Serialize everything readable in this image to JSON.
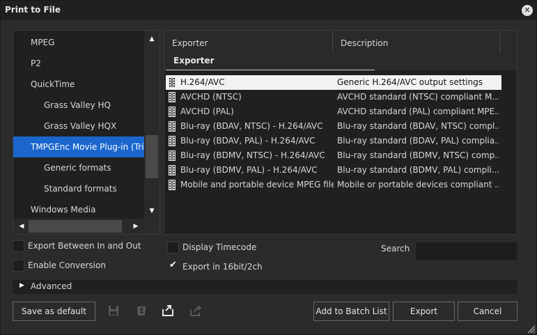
{
  "window": {
    "title": "Print to File",
    "close_glyph": "✕"
  },
  "left_list": {
    "items": [
      {
        "label": "MPEG",
        "level": 0,
        "selected": false
      },
      {
        "label": "P2",
        "level": 0,
        "selected": false
      },
      {
        "label": "QuickTime",
        "level": 0,
        "selected": false
      },
      {
        "label": "Grass Valley HQ",
        "level": 1,
        "selected": false
      },
      {
        "label": "Grass Valley HQX",
        "level": 1,
        "selected": false
      },
      {
        "label": "TMPGEnc Movie Plug-in (Tria",
        "level": 0,
        "selected": true
      },
      {
        "label": "Generic formats",
        "level": 1,
        "selected": false
      },
      {
        "label": "Standard formats",
        "level": 1,
        "selected": false
      },
      {
        "label": "Windows Media",
        "level": 0,
        "selected": false
      }
    ],
    "scroll_up": "▲",
    "scroll_down": "▼",
    "scroll_left": "◀",
    "scroll_right": "▶"
  },
  "exporter_table": {
    "columns": [
      "Exporter",
      "Description"
    ],
    "group": "Exporter",
    "row_icon": "film-strip-icon",
    "rows": [
      {
        "name": "H.264/AVC",
        "description": "Generic H.264/AVC output settings",
        "selected": true
      },
      {
        "name": "AVCHD (NTSC)",
        "description": "AVCHD standard (NTSC) compliant M...",
        "selected": false
      },
      {
        "name": "AVCHD (PAL)",
        "description": "AVCHD standard (PAL) compliant MPE...",
        "selected": false
      },
      {
        "name": "Blu-ray (BDAV, NTSC) - H.264/AVC",
        "description": "Blu-ray standard (BDAV, NTSC) compl...",
        "selected": false
      },
      {
        "name": "Blu-ray (BDAV, PAL) - H.264/AVC",
        "description": "Blu-ray standard (BDAV, PAL) complia...",
        "selected": false
      },
      {
        "name": "Blu-ray (BDMV, NTSC) - H.264/AVC",
        "description": "Blu-ray standard (BDMV, NTSC) comp...",
        "selected": false
      },
      {
        "name": "Blu-ray (BDMV, PAL) - H.264/AVC",
        "description": "Blu-ray standard (BDMV, PAL) compli...",
        "selected": false
      },
      {
        "name": "Mobile and portable device MPEG file",
        "description": "Mobile or portable devices compliant ...",
        "selected": false
      }
    ]
  },
  "options": {
    "export_between": {
      "label": "Export Between In and Out",
      "checked": false
    },
    "enable_conversion": {
      "label": "Enable Conversion",
      "checked": false
    },
    "display_timecode": {
      "label": "Display Timecode",
      "checked": false
    },
    "export_16bit": {
      "label": "Export in 16bit/2ch",
      "checked": true
    },
    "check_glyph": "✔"
  },
  "search": {
    "label": "Search",
    "value": ""
  },
  "advanced": {
    "label": "Advanced",
    "glyph": "▶"
  },
  "buttons": {
    "save_default": "Save as default",
    "add_batch": "Add to Batch List",
    "export": "Export",
    "cancel": "Cancel"
  },
  "toolbar_icons": [
    "save-preset-icon",
    "delete-preset-icon",
    "import-preset-icon",
    "export-preset-icon"
  ],
  "colors": {
    "selection": "#1a66cc",
    "panel": "#202020",
    "background": "#2b2b2b"
  }
}
